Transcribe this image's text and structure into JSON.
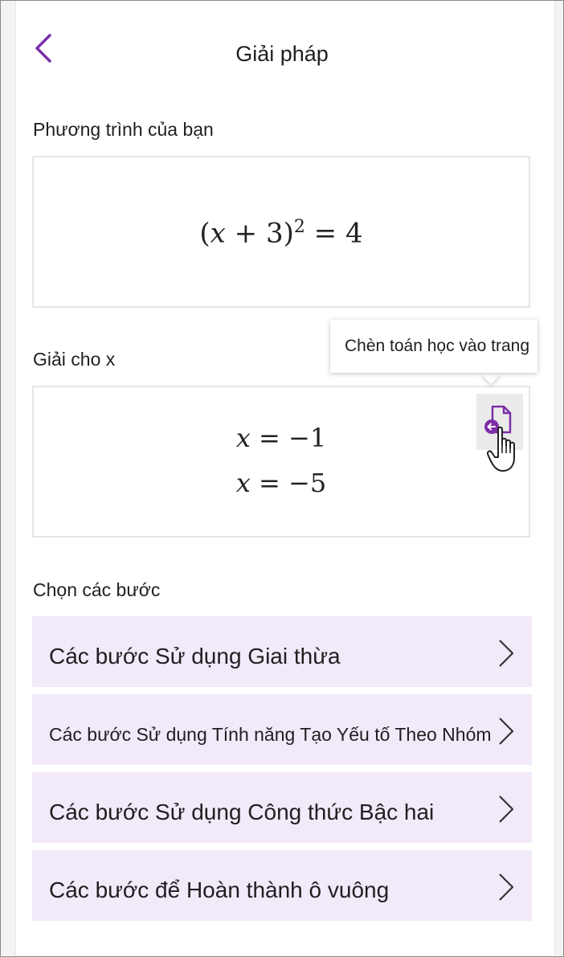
{
  "header": {
    "title": "Giải pháp",
    "back_icon": "chevron-left-icon",
    "accent_color": "#7d2fa8"
  },
  "equation_section": {
    "label": "Phương trình của bạn",
    "equation": {
      "lhs_open": "(",
      "var": "x",
      "op": "+",
      "const": "3",
      "lhs_close": ")",
      "exponent": "2",
      "eq": "=",
      "rhs": "4"
    }
  },
  "solution_section": {
    "label": "Giải cho x",
    "solutions": [
      {
        "var": "x",
        "eq": "=",
        "value": "−1"
      },
      {
        "var": "x",
        "eq": "=",
        "value": "−5"
      }
    ],
    "insert_button_icon": "insert-into-page-icon",
    "tooltip": "Chèn toán học vào trang"
  },
  "steps_section": {
    "label": "Chọn các bước",
    "items": [
      {
        "label": "Các bước Sử dụng Giai thừa"
      },
      {
        "label": "Các bước Sử dụng Tính năng Tạo Yếu tố Theo Nhóm"
      },
      {
        "label": "Các bước Sử dụng Công thức Bậc hai"
      },
      {
        "label": "Các bước để Hoàn thành ô vuông"
      }
    ],
    "item_background": "#f2e9f9"
  }
}
